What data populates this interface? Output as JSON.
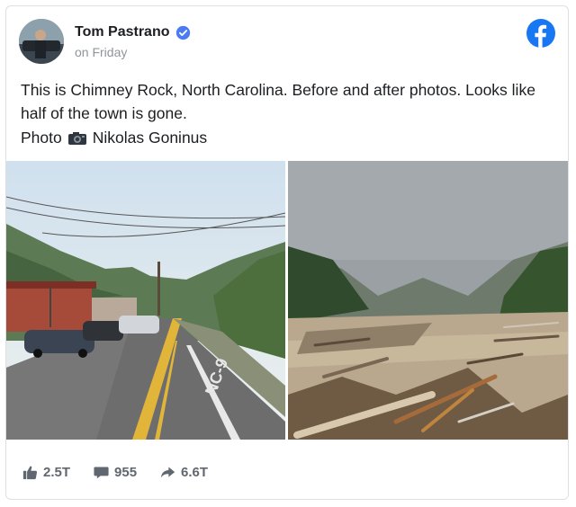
{
  "post": {
    "author": "Tom Pastrano",
    "time": "on Friday",
    "text": "This is Chimney Rock, North Carolina. Before and after photos. Looks like half of the town is gone.",
    "credit_prefix": "Photo",
    "credit_name": "Nikolas Goninus",
    "road_sign": "NC-9"
  },
  "icons": {
    "verified": "verified-badge-icon",
    "platform": "facebook-logo-icon",
    "camera": "camera-icon",
    "like": "thumbs-up-icon",
    "comment": "comment-bubble-icon",
    "share": "share-arrow-icon"
  },
  "stats": {
    "likes": "2.5T",
    "comments": "955",
    "shares": "6.6T"
  },
  "colors": {
    "brand": "#1877f2",
    "verified": "#4a7bf3",
    "muted": "#606770"
  }
}
